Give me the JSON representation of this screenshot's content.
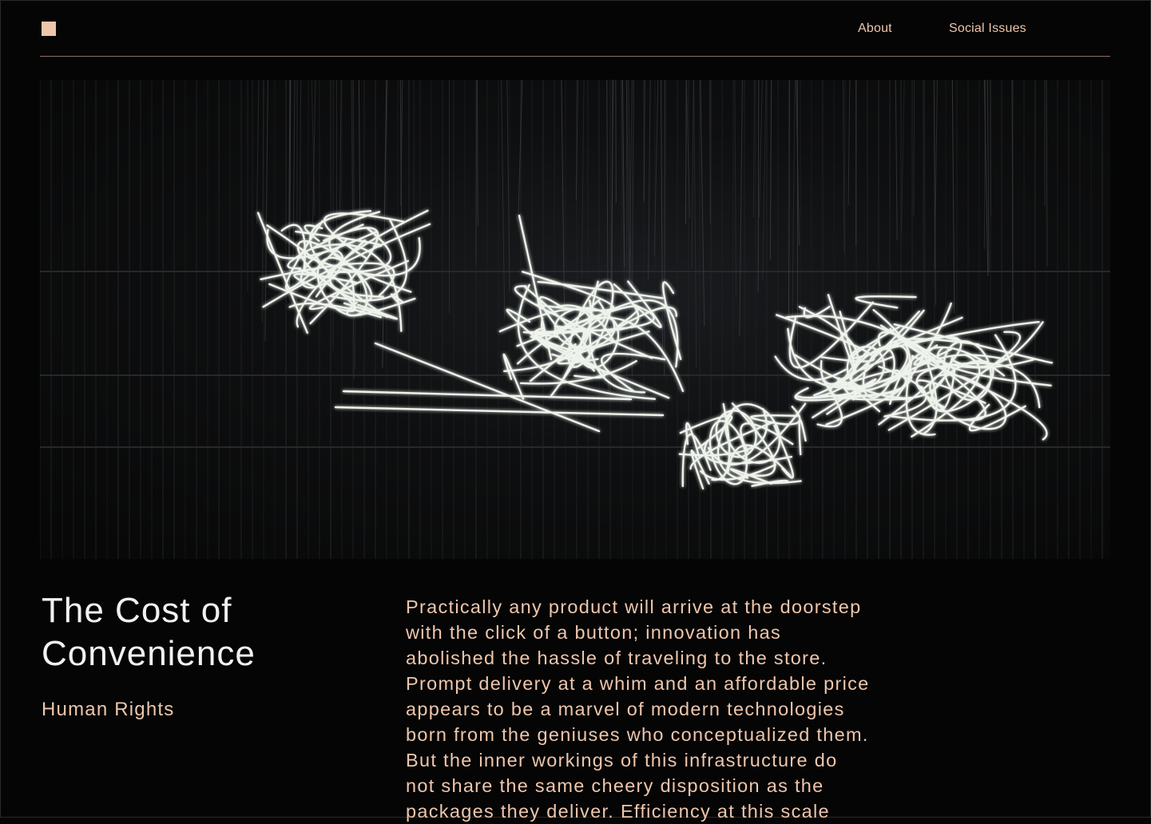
{
  "header": {
    "logo_icon": "square-logo",
    "nav": [
      {
        "label": "About"
      },
      {
        "label": "Social Issues"
      }
    ]
  },
  "hero": {
    "image_icon": "neon-light-sculpture-image"
  },
  "article": {
    "title": "The Cost of Convenience",
    "category": "Human Rights",
    "body": "Practically any product will arrive at the doorstep\nwith the click of a button; innovation has\nabolished the hassle of traveling to the store.\nPrompt delivery at a whim and an affordable price\nappears to be a marvel of modern technologies\nborn from the geniuses who conceptualized them.\nBut the inner workings of this infrastructure do\nnot share the same cheery disposition as the\npackages they deliver. Efficiency at this scale"
  },
  "colors": {
    "background": "#050505",
    "accent": "#eec6ac",
    "title": "#f1f1f1",
    "rule": "#8a6f5e"
  }
}
